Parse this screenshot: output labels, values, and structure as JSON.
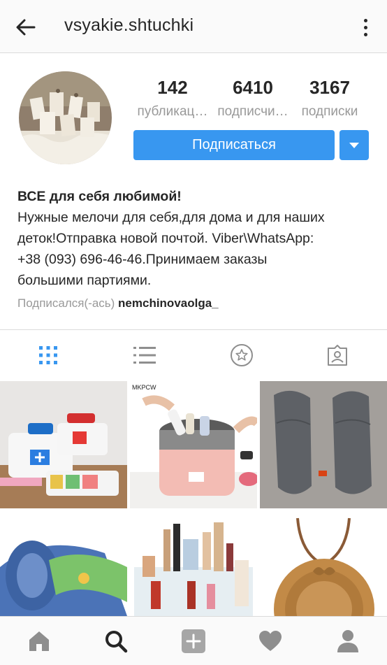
{
  "header": {
    "username": "vsyakie.shtuchki"
  },
  "stats": [
    {
      "value": "142",
      "label": "публикац…"
    },
    {
      "value": "6410",
      "label": "подписчи…"
    },
    {
      "value": "3167",
      "label": "подписки"
    }
  ],
  "actions": {
    "follow_label": "Подписаться"
  },
  "bio": {
    "name": "ВСЕ для себя любимой!",
    "line1": "Нужные мелочи для себя,для дома и для наших",
    "line2": "деток!Отправка новой почтой. Viber\\WhatsApp:",
    "line3": "+38 (093) 696-46-46.Принимаем заказы",
    "line4": "большими партиями.",
    "followed_by_prefix": "Подписался(-ась)",
    "followed_by_user": "nemchinovaolga_"
  },
  "grid": {
    "watermark": "MKPCW"
  },
  "colors": {
    "accent": "#3897f0",
    "text": "#262626",
    "muted": "#999999",
    "border": "#dbdbdb"
  },
  "icons": {
    "tabs": [
      "grid-icon",
      "list-icon",
      "star-icon",
      "tagged-icon"
    ],
    "bottom_nav": [
      "home-icon",
      "search-icon",
      "add-icon",
      "heart-icon",
      "profile-icon"
    ]
  }
}
